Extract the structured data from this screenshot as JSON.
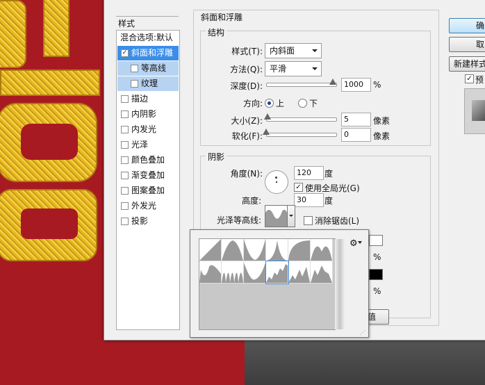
{
  "background": {
    "canvas_color": "#a81a22",
    "gold_color": "#e6b81c",
    "dark_color": "#4a4a4a"
  },
  "dialog": {
    "left_panel": {
      "header": "样式",
      "items": [
        {
          "label": "混合选项:默认",
          "checkbox": false,
          "checked": false,
          "state": "normal"
        },
        {
          "label": "斜面和浮雕",
          "checkbox": true,
          "checked": true,
          "state": "selected"
        },
        {
          "label": "等高线",
          "checkbox": true,
          "checked": false,
          "state": "sub-selected"
        },
        {
          "label": "纹理",
          "checkbox": true,
          "checked": false,
          "state": "sub-selected"
        },
        {
          "label": "描边",
          "checkbox": true,
          "checked": false,
          "state": "normal"
        },
        {
          "label": "内阴影",
          "checkbox": true,
          "checked": false,
          "state": "normal"
        },
        {
          "label": "内发光",
          "checkbox": true,
          "checked": false,
          "state": "normal"
        },
        {
          "label": "光泽",
          "checkbox": true,
          "checked": false,
          "state": "normal"
        },
        {
          "label": "颜色叠加",
          "checkbox": true,
          "checked": false,
          "state": "normal"
        },
        {
          "label": "渐变叠加",
          "checkbox": true,
          "checked": false,
          "state": "normal"
        },
        {
          "label": "图案叠加",
          "checkbox": true,
          "checked": false,
          "state": "normal"
        },
        {
          "label": "外发光",
          "checkbox": true,
          "checked": false,
          "state": "normal"
        },
        {
          "label": "投影",
          "checkbox": true,
          "checked": false,
          "state": "normal"
        }
      ]
    },
    "bevel": {
      "title": "斜面和浮雕",
      "structure": {
        "title": "结构",
        "style_label": "样式(T):",
        "style_value": "内斜面",
        "technique_label": "方法(Q):",
        "technique_value": "平滑",
        "depth_label": "深度(D):",
        "depth_value": "1000",
        "depth_unit": "%",
        "depth_level": 1.0,
        "direction_label": "方向:",
        "direction_up": "上",
        "direction_down": "下",
        "direction_selected": "上",
        "size_label": "大小(Z):",
        "size_value": "5",
        "size_unit": "像素",
        "size_level": 0.02,
        "soften_label": "软化(F):",
        "soften_value": "0",
        "soften_unit": "像素",
        "soften_level": 0.0
      },
      "shading": {
        "title": "阴影",
        "angle_label": "角度(N):",
        "angle_value": "120",
        "angle_unit": "度",
        "global_light_label": "使用全局光(G)",
        "global_light_checked": true,
        "altitude_label": "高度:",
        "altitude_value": "30",
        "altitude_unit": "度",
        "gloss_label": "光泽等高线:",
        "antialias_label": "消除锯齿(L)",
        "antialias_checked": false,
        "percent_1": "%",
        "percent_2": "%",
        "reset_partial": "值"
      }
    },
    "buttons": {
      "ok_partial": "确",
      "cancel_partial": "取",
      "new_style_partial": "新建样式",
      "preview_partial": "预",
      "preview_checked": true
    },
    "contour_picker": {
      "gear_icon": "gear-icon",
      "contours": [
        "linear",
        "cone",
        "cone-inverted",
        "gaussian",
        "half-round",
        "ring",
        "ring-double",
        "rolling-slope",
        "rounded-steps",
        "sawtooth",
        "cove-deep",
        "cove-shallow"
      ]
    }
  }
}
